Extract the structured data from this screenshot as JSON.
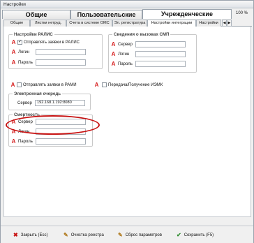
{
  "window": {
    "title": "Настройки"
  },
  "main_tabs": [
    {
      "label": "Общие"
    },
    {
      "label": "Пользовательские"
    },
    {
      "label": "Учрежденческие"
    }
  ],
  "zoom": "100 %",
  "sub_tabs": [
    {
      "label": "Общие"
    },
    {
      "label": "Листки нетруд."
    },
    {
      "label": "Счета в системе ОМС"
    },
    {
      "label": "Эл. регистратура"
    },
    {
      "label": "Настройки интеграции"
    },
    {
      "label": "Настройки"
    }
  ],
  "arrows": {
    "left": "◀",
    "right": "▶"
  },
  "ralis": {
    "title": "Настройки РАЛИС",
    "send_label": "Отправлять заявки в РАЛИС",
    "send_checked": true,
    "login_label": "Логин",
    "password_label": "Пароль",
    "login_value": "",
    "password_value": ""
  },
  "smp": {
    "title": "Сведения о вызовах СМП",
    "server_label": "Сервер",
    "login_label": "Логин",
    "password_label": "Пароль",
    "server_value": "",
    "login_value": "",
    "password_value": ""
  },
  "rami": {
    "label": "Отправлять заявки в РАМИ",
    "checked": false
  },
  "iemk": {
    "label": "Передача/Получение ИЭМК",
    "checked": false
  },
  "queue": {
    "title": "Электронная очередь",
    "server_label": "Сервер",
    "server_value": "192.168.1.192:8080"
  },
  "death": {
    "title": "Смертность",
    "server_label": "Сервер",
    "login_label": "Логин",
    "password_label": "Пароль",
    "server_value": "",
    "login_value": "",
    "password_value": ""
  },
  "required_mark": "A",
  "checkmark": "✓",
  "buttons": {
    "close": {
      "label": "Закрыть (Esc)",
      "icon": "✖"
    },
    "clear": {
      "label": "Очистка реестра",
      "icon": "✎"
    },
    "reset": {
      "label": "Сброс параметров",
      "icon": "✎"
    },
    "save": {
      "label": "Сохранить (F5)",
      "icon": "✔"
    }
  },
  "colors": {
    "required": "#d61e1e",
    "highlight": "#c81414",
    "save": "#2a8a2a",
    "close": "#c81414"
  }
}
